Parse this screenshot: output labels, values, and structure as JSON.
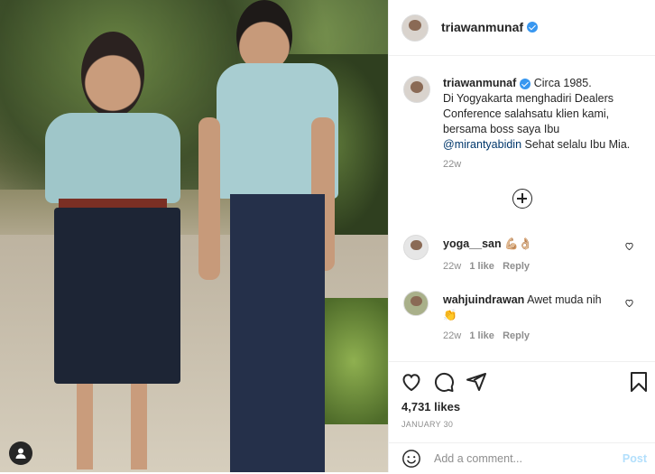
{
  "photo": {
    "alt_subjects": "two people standing on a garden path"
  },
  "post": {
    "author": "triawanmunaf",
    "caption_line1": "Circa 1985.",
    "caption_body": "Di Yogyakarta menghadiri Dealers Conference salahsatu klien kami, bersama boss saya Ibu",
    "mention": "@mirantyabidin",
    "caption_tail": " Sehat selalu Ibu Mia.",
    "caption_age": "22w"
  },
  "comments": [
    {
      "user": "yoga__san",
      "text": "💪🏼👌🏼",
      "age": "22w",
      "likes": "1 like",
      "reply": "Reply"
    },
    {
      "user": "wahjuindrawan",
      "text": "Awet muda nih",
      "text2": "👏",
      "age": "22w",
      "likes": "1 like",
      "reply": "Reply"
    }
  ],
  "stats": {
    "likes": "4,731 likes",
    "date": "JANUARY 30"
  },
  "composer": {
    "placeholder": "Add a comment...",
    "post_label": "Post"
  },
  "colors": {
    "verified": "#3897f0",
    "mention": "#00376b",
    "muted": "#8e8e8e",
    "post_disabled": "#b2dffc"
  }
}
